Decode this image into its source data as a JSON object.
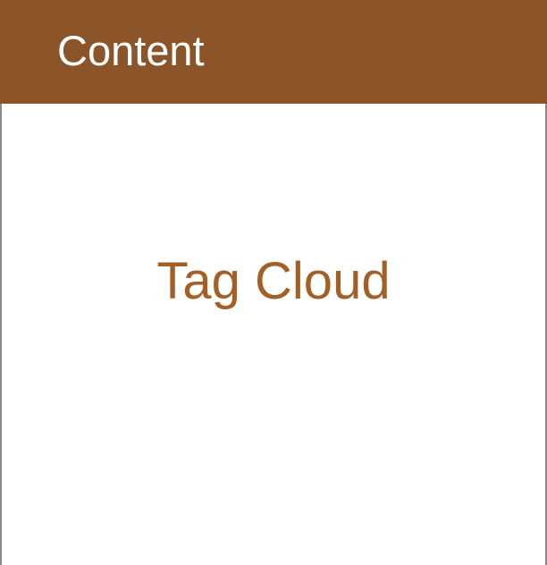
{
  "panel": {
    "title": "Content",
    "body_label": "Tag Cloud"
  },
  "colors": {
    "header_background": "#8b5529",
    "header_text": "#ffffff",
    "body_text": "#a35f26",
    "border": "#8a8a8a"
  }
}
